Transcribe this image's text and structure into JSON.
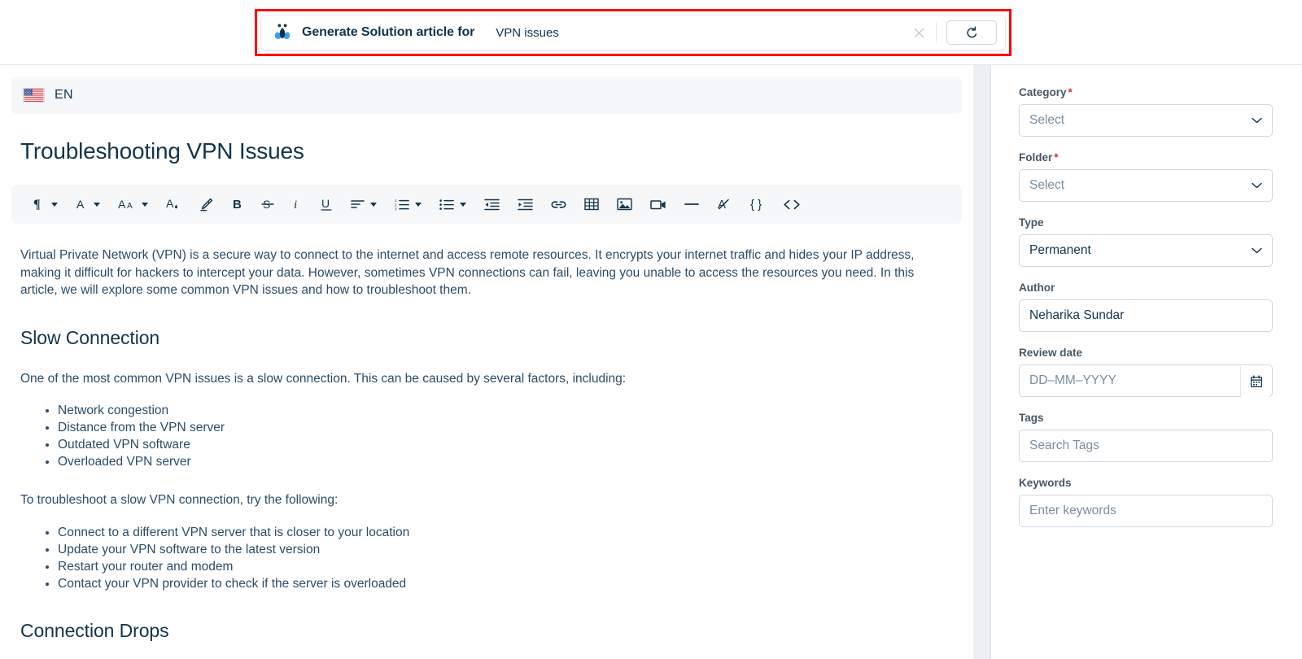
{
  "ai_banner": {
    "icon": "freddy-ai-icon",
    "label": "Generate Solution article for",
    "query": "VPN issues",
    "close_icon": "close-icon",
    "regenerate_icon": "regenerate-icon",
    "highlight_color": "#ff0000"
  },
  "editor": {
    "language": {
      "flag": "us-flag-icon",
      "code": "EN"
    },
    "article_title": "Troubleshooting VPN Issues",
    "toolbar": [
      {
        "name": "paragraph-style",
        "glyph": "¶",
        "caret": true
      },
      {
        "name": "font-color",
        "glyph": "A",
        "caret": true
      },
      {
        "name": "font-size",
        "glyph": "Aᴀ",
        "caret": true
      },
      {
        "name": "text-highlight-color",
        "glyph": "A",
        "caret": false
      },
      {
        "name": "highlighter-pen",
        "glyph": "✐",
        "caret": false
      },
      {
        "name": "bold",
        "glyph": "B",
        "caret": false
      },
      {
        "name": "strikethrough",
        "glyph": "S̶",
        "caret": false
      },
      {
        "name": "italic",
        "glyph": "i",
        "caret": false
      },
      {
        "name": "underline",
        "glyph": "U",
        "caret": false
      },
      {
        "name": "text-align",
        "glyph": "≡",
        "caret": true
      },
      {
        "name": "ordered-list",
        "glyph": "②",
        "caret": true
      },
      {
        "name": "unordered-list",
        "glyph": "☰",
        "caret": true
      },
      {
        "name": "decrease-indent",
        "glyph": "⇤",
        "caret": false
      },
      {
        "name": "increase-indent",
        "glyph": "⇥",
        "caret": false
      },
      {
        "name": "insert-link",
        "glyph": "🔗",
        "caret": false
      },
      {
        "name": "insert-table",
        "glyph": "▦",
        "caret": false
      },
      {
        "name": "insert-image",
        "glyph": "🖼",
        "caret": false
      },
      {
        "name": "insert-video",
        "glyph": "▶",
        "caret": false
      },
      {
        "name": "horizontal-rule",
        "glyph": "—",
        "caret": false
      },
      {
        "name": "clear-formatting",
        "glyph": "A̶",
        "caret": false
      },
      {
        "name": "insert-placeholder",
        "glyph": "{ }",
        "caret": false
      },
      {
        "name": "source-code",
        "glyph": "< >",
        "caret": false
      }
    ],
    "content": {
      "intro": "Virtual Private Network (VPN) is a secure way to connect to the internet and access remote resources. It encrypts your internet traffic and hides your IP address, making it difficult for hackers to intercept your data. However, sometimes VPN connections can fail, leaving you unable to access the resources you need. In this article, we will explore some common VPN issues and how to troubleshoot them.",
      "section1_heading": "Slow Connection",
      "section1_intro": "One of the most common VPN issues is a slow connection. This can be caused by several factors, including:",
      "section1_causes": [
        "Network congestion",
        "Distance from the VPN server",
        "Outdated VPN software",
        "Overloaded VPN server"
      ],
      "section1_fix_intro": "To troubleshoot a slow VPN connection, try the following:",
      "section1_fixes": [
        "Connect to a different VPN server that is closer to your location",
        "Update your VPN software to the latest version",
        "Restart your router and modem",
        "Contact your VPN provider to check if the server is overloaded"
      ],
      "section2_heading": "Connection Drops"
    }
  },
  "sidebar": {
    "fields": [
      {
        "label": "Category",
        "required": true,
        "type": "select",
        "value": "Select",
        "is_placeholder": true,
        "name": "category"
      },
      {
        "label": "Folder",
        "required": true,
        "type": "select",
        "value": "Select",
        "is_placeholder": true,
        "name": "folder"
      },
      {
        "label": "Type",
        "required": false,
        "type": "select",
        "value": "Permanent",
        "is_placeholder": false,
        "name": "type"
      },
      {
        "label": "Author",
        "required": false,
        "type": "text",
        "value": "Neharika Sundar",
        "is_placeholder": false,
        "name": "author"
      },
      {
        "label": "Review date",
        "required": false,
        "type": "date",
        "value": "DD–MM–YYYY",
        "is_placeholder": true,
        "name": "review-date"
      },
      {
        "label": "Tags",
        "required": false,
        "type": "text",
        "value": "Search Tags",
        "is_placeholder": true,
        "name": "tags"
      },
      {
        "label": "Keywords",
        "required": false,
        "type": "text",
        "value": "Enter keywords",
        "is_placeholder": true,
        "name": "keywords"
      }
    ]
  },
  "colors": {
    "text_primary": "#12344d",
    "text_body": "#2c4c68",
    "border": "#cfd7df",
    "panel_bg": "#f5f7f9",
    "accent_blue": "#2c5cc5",
    "required_red": "#d72d30"
  }
}
